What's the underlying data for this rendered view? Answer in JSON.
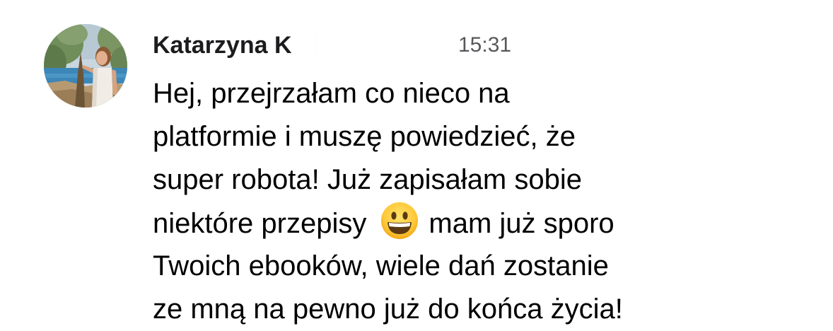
{
  "message": {
    "sender": "Katarzyna K",
    "time": "15:31",
    "avatar_icon": "profile-photo",
    "lines": [
      "Hej, przejrzałam co nieco na",
      "platformie i muszę powiedzieć, że",
      "super robota! Już zapisałam sobie",
      "niektóre przepisy",
      "mam już sporo",
      "Twoich ebooków, wiele dań zostanie",
      "ze mną na pewno już do końca życia!"
    ],
    "emoji_icon": "grinning-face-emoji"
  }
}
